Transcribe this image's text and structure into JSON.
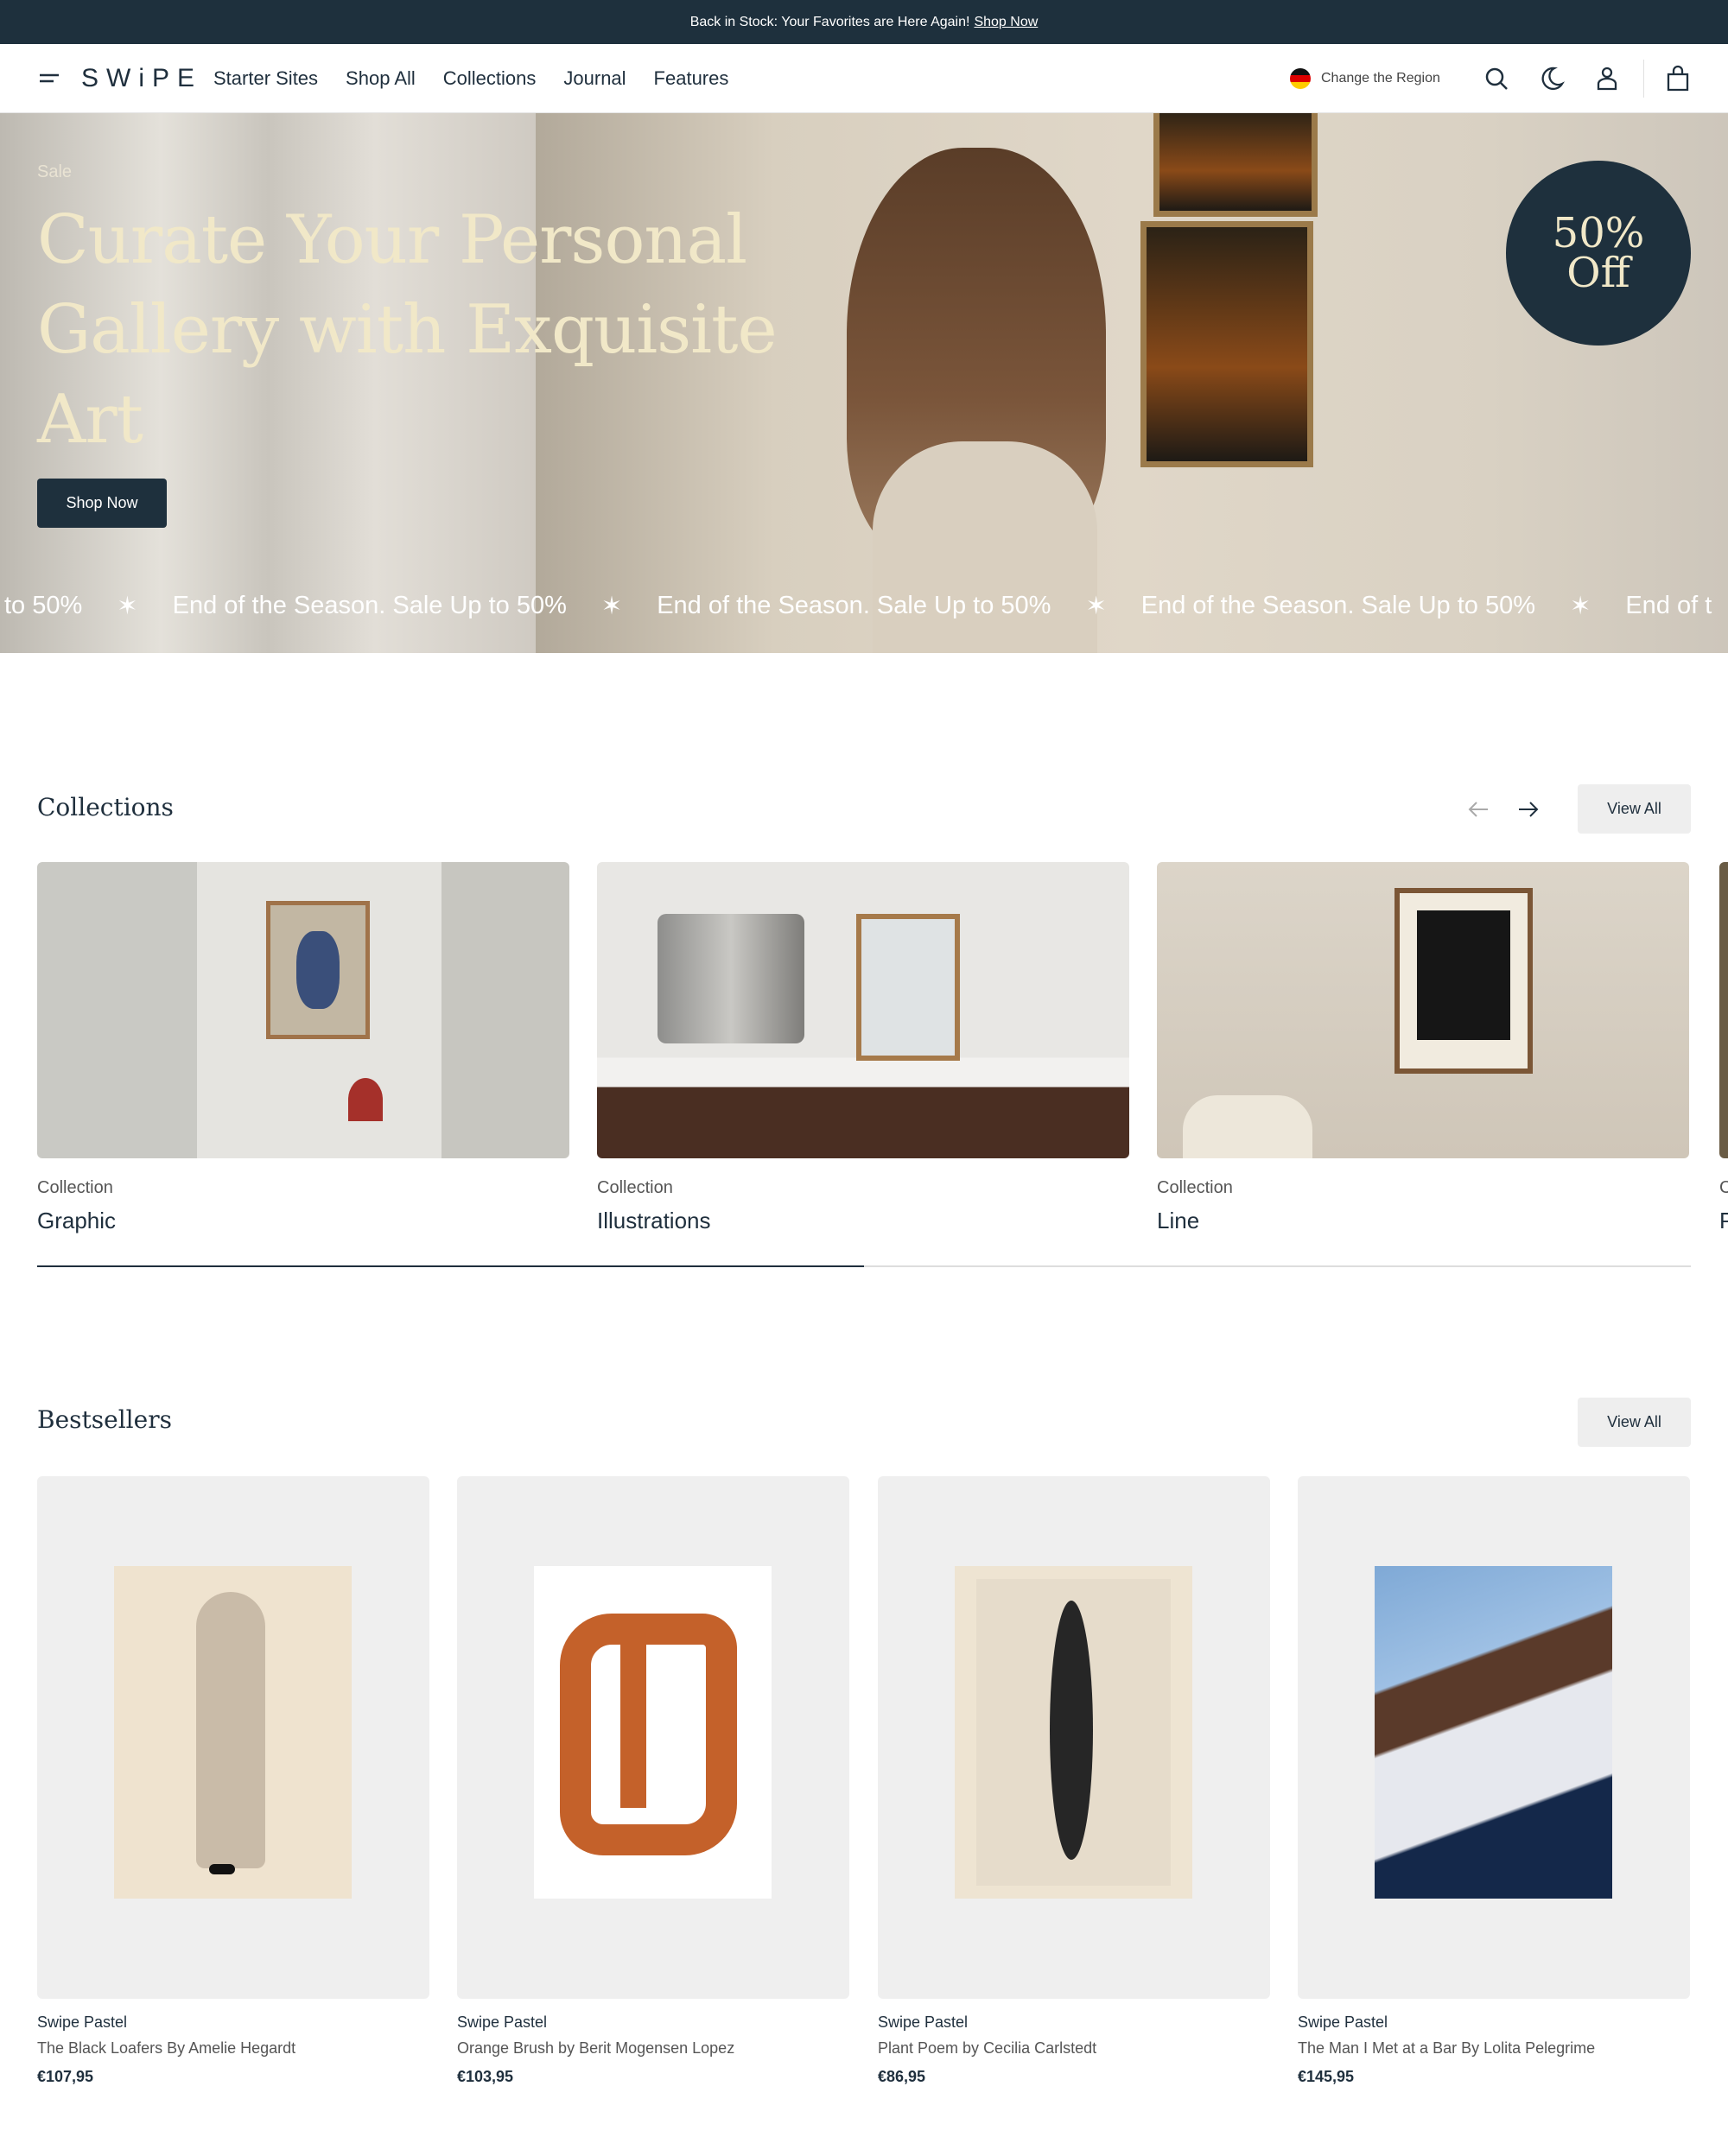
{
  "announcement": {
    "text": "Back in Stock: Your Favorites are Here Again!",
    "link": "Shop Now"
  },
  "header": {
    "logo": "SWiPE",
    "nav": [
      "Starter Sites",
      "Shop All",
      "Collections",
      "Journal",
      "Features"
    ],
    "region": "Change the Region"
  },
  "hero": {
    "eyebrow": "Sale",
    "title": "Curate Your Personal Gallery with Exquisite Art",
    "button": "Shop Now",
    "badge": "50% Off",
    "marquee": "End of the Season. Sale Up to 50%",
    "marquee_lead": "to 50%",
    "marquee_tail": "End of t"
  },
  "collections": {
    "heading": "Collections",
    "view_all": "View All",
    "progress": 0.5,
    "items": [
      {
        "label": "Collection",
        "name": "Graphic"
      },
      {
        "label": "Collection",
        "name": "Illustrations"
      },
      {
        "label": "Collection",
        "name": "Line"
      },
      {
        "label": "C",
        "name": "P"
      }
    ]
  },
  "bestsellers": {
    "heading": "Bestsellers",
    "view_all": "View All",
    "items": [
      {
        "vendor": "Swipe Pastel",
        "title": "The Black Loafers By Amelie Hegardt",
        "price": "€107,95"
      },
      {
        "vendor": "Swipe Pastel",
        "title": "Orange Brush by Berit Mogensen Lopez",
        "price": "€103,95"
      },
      {
        "vendor": "Swipe Pastel",
        "title": "Plant Poem by Cecilia Carlstedt",
        "price": "€86,95"
      },
      {
        "vendor": "Swipe Pastel",
        "title": "The Man I Met at a Bar By Lolita Pelegrime",
        "price": "€145,95"
      }
    ]
  },
  "colors": {
    "primary": "#1e303d",
    "hero_title": "#f1e8c8",
    "card_bg": "#efefef"
  }
}
